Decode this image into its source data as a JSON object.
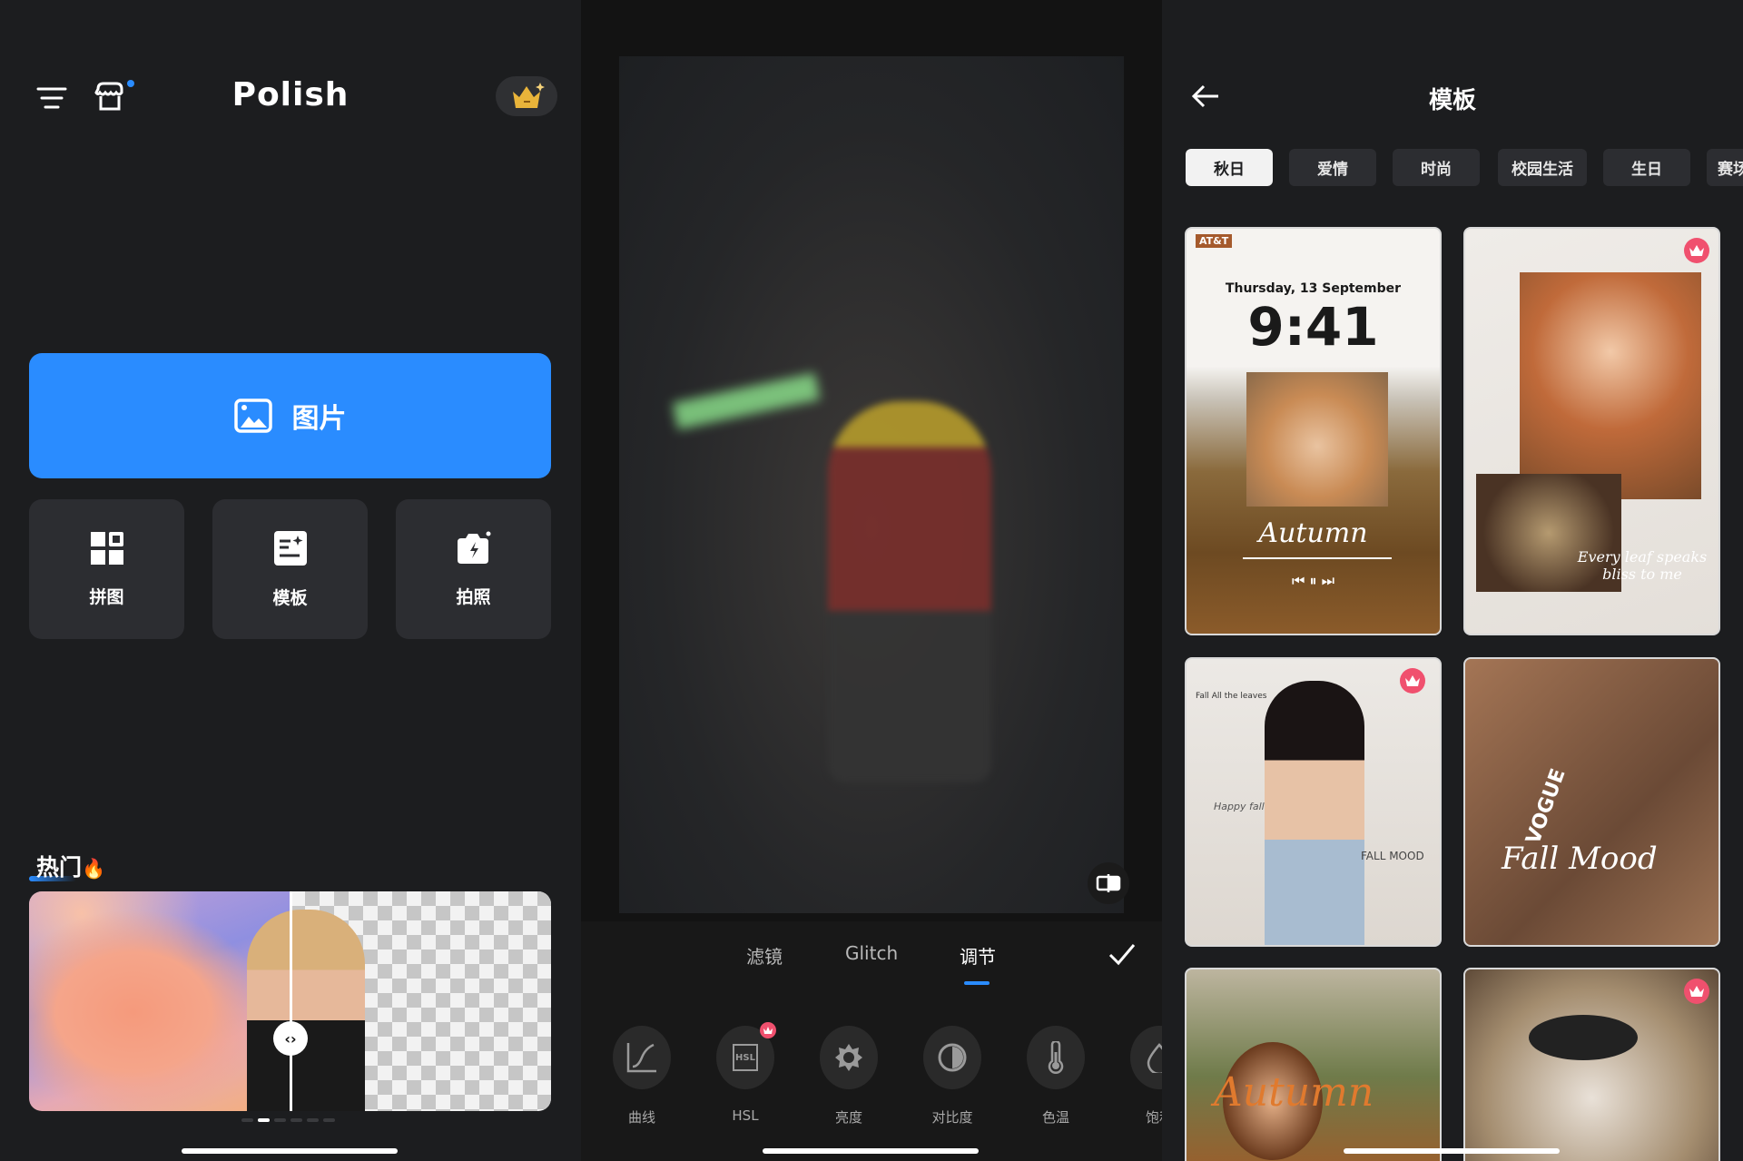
{
  "colors": {
    "accent": "#2a8cff",
    "premium_badge": "#f0506e",
    "vip_gold": "#e9b43a"
  },
  "home": {
    "app_name": "Polish",
    "icons": [
      "menu-icon",
      "store-icon",
      "crown-icon"
    ],
    "primary_button": {
      "label": "图片",
      "icon": "image-icon"
    },
    "tiles": [
      {
        "label": "拼图",
        "icon": "collage-grid-icon"
      },
      {
        "label": "模板",
        "icon": "template-icon"
      },
      {
        "label": "拍照",
        "icon": "camera-flash-icon"
      }
    ],
    "hot_section": {
      "title": "热门",
      "emoji": "🔥",
      "handle": "‹›",
      "active_dot": 1,
      "dot_count": 6
    }
  },
  "editor": {
    "tabs": [
      {
        "label": "滤镜"
      },
      {
        "label": "Glitch"
      },
      {
        "label": "调节",
        "active": true
      }
    ],
    "tools": [
      {
        "label": "曲线",
        "icon": "curve-icon"
      },
      {
        "label": "HSL",
        "icon": "hsl-icon",
        "icon_text": "HSL",
        "premium": true
      },
      {
        "label": "亮度",
        "icon": "brightness-icon"
      },
      {
        "label": "对比度",
        "icon": "contrast-icon"
      },
      {
        "label": "色温",
        "icon": "thermometer-icon"
      },
      {
        "label": "饱和",
        "icon": "saturation-icon"
      }
    ]
  },
  "templates": {
    "title": "模板",
    "categories": [
      {
        "label": "秋日",
        "active": true
      },
      {
        "label": "爱情"
      },
      {
        "label": "时尚"
      },
      {
        "label": "校园生活"
      },
      {
        "label": "生日"
      },
      {
        "label": "赛场"
      }
    ],
    "cards": [
      {
        "carrier": "AT&T",
        "date": "Thursday, 13 September",
        "time": "9:41",
        "song": "Autumn",
        "premium": false
      },
      {
        "caption": "Every leaf speaks bliss to me",
        "premium": true
      },
      {
        "caption_top": "Fall All the leaves",
        "caption_mid": "Happy fall",
        "caption_right": "FALL MOOD",
        "premium": true
      },
      {
        "caption": "Fall Mood",
        "brand": "VOGUE",
        "premium": false
      },
      {
        "caption": "Autumn",
        "premium": false
      },
      {
        "premium": true
      }
    ]
  }
}
